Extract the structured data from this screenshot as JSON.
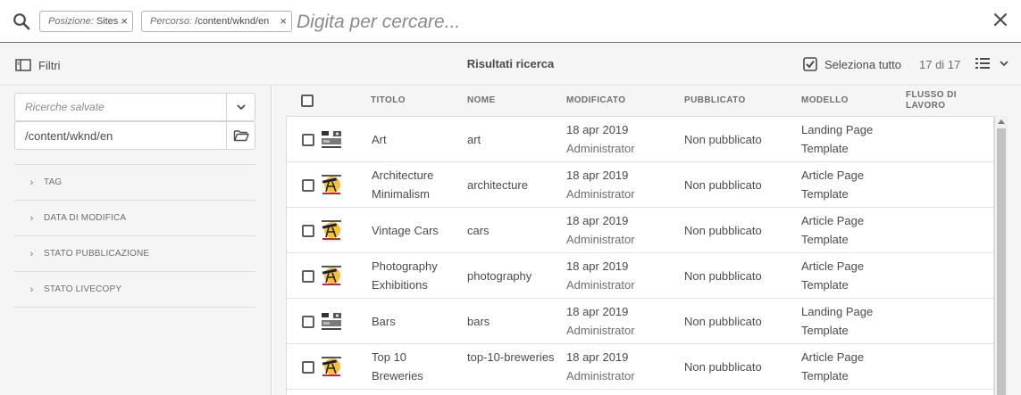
{
  "search": {
    "tags": [
      {
        "label": "Posizione:",
        "value": " Sites"
      },
      {
        "label": "Percorso:",
        "value": " /content/wknd/en"
      }
    ],
    "placeholder": "Digita per cercare...",
    "tag_close_glyph": "×"
  },
  "actionbar": {
    "filter_label": "Filtri",
    "title": "Risultati ricerca",
    "select_all_label": "Seleziona tutto",
    "count": "17 di 17"
  },
  "rail": {
    "saved_searches_placeholder": "Ricerche salvate",
    "path_value": "/content/wknd/en",
    "facets": [
      "TAG",
      "DATA DI MODIFICA",
      "STATO PUBBLICAZIONE",
      "STATO LIVECOPY"
    ]
  },
  "table": {
    "columns": {
      "title": "TITOLO",
      "name": "NOME",
      "modified": "MODIFICATO",
      "published": "PUBBLICATO",
      "template": "MODELLO",
      "workflow": "FLUSSO DI LAVORO"
    },
    "rows": [
      {
        "title": "Art",
        "name": "art",
        "date": "18 apr 2019",
        "user": "Administrator",
        "status": "Non pubblicato",
        "template": "Landing Page Template",
        "thumb": "landing-thumbnail"
      },
      {
        "title": "Architecture Minimalism",
        "name": "architecture",
        "date": "18 apr 2019",
        "user": "Administrator",
        "status": "Non pubblicato",
        "template": "Article Page Template",
        "thumb": "article-thumbnail"
      },
      {
        "title": "Vintage Cars",
        "name": "cars",
        "date": "18 apr 2019",
        "user": "Administrator",
        "status": "Non pubblicato",
        "template": "Article Page Template",
        "thumb": "article-thumbnail"
      },
      {
        "title": "Photography Exhibitions",
        "name": "photography",
        "date": "18 apr 2019",
        "user": "Administrator",
        "status": "Non pubblicato",
        "template": "Article Page Template",
        "thumb": "article-thumbnail"
      },
      {
        "title": "Bars",
        "name": "bars",
        "date": "18 apr 2019",
        "user": "Administrator",
        "status": "Non pubblicato",
        "template": "Landing Page Template",
        "thumb": "landing-thumbnail"
      },
      {
        "title": "Top 10 Breweries",
        "name": "top-10-breweries",
        "date": "18 apr 2019",
        "user": "Administrator",
        "status": "Non pubblicato",
        "template": "Article Page Template",
        "thumb": "article-thumbnail"
      }
    ]
  },
  "colors": {
    "accent": "#2680eb",
    "panel_bg": "#f5f5f5",
    "text": "#4b4b4b"
  }
}
